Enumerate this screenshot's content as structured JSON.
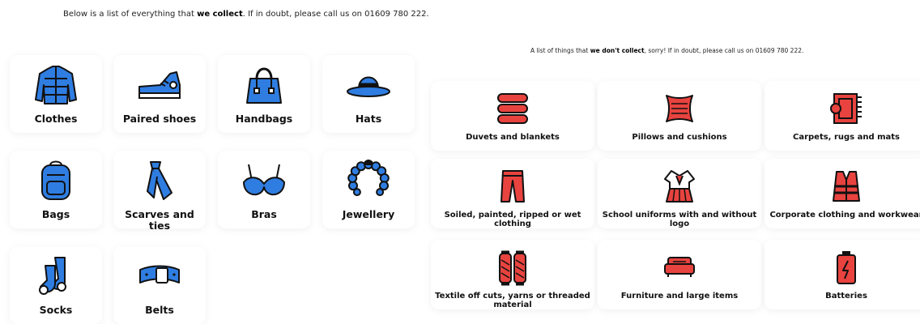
{
  "collect": {
    "intro": {
      "before": "Below is a list of everything that ",
      "bold": "we collect",
      "after": ". If in doubt, please call us on 01609 780 222."
    },
    "items": [
      {
        "label": "Clothes",
        "icon": "jacket-icon"
      },
      {
        "label": "Paired shoes",
        "icon": "sneaker-icon"
      },
      {
        "label": "Handbags",
        "icon": "handbag-icon"
      },
      {
        "label": "Hats",
        "icon": "hat-icon"
      },
      {
        "label": "Bags",
        "icon": "backpack-icon"
      },
      {
        "label": "Scarves and ties",
        "icon": "tie-icon"
      },
      {
        "label": "Bras",
        "icon": "bra-icon"
      },
      {
        "label": "Jewellery",
        "icon": "necklace-icon"
      },
      {
        "label": "Socks",
        "icon": "socks-icon"
      },
      {
        "label": "Belts",
        "icon": "belt-icon"
      }
    ]
  },
  "dont_collect": {
    "intro": {
      "before": "A list of things that ",
      "bold": "we don't collect",
      "after": ", sorry! If in doubt, please call us on 01609 780 222."
    },
    "items": [
      {
        "label": "Duvets and blankets",
        "icon": "blankets-icon"
      },
      {
        "label": "Pillows and cushions",
        "icon": "pillow-icon"
      },
      {
        "label": "Carpets, rugs and mats",
        "icon": "rug-icon"
      },
      {
        "label": "Soiled, painted, ripped or wet clothing",
        "icon": "trousers-icon"
      },
      {
        "label": "School uniforms with and without logo",
        "icon": "uniform-icon"
      },
      {
        "label": "Corporate clothing and workwear",
        "icon": "hi-vis-vest-icon"
      },
      {
        "label": "Textile off cuts, yarns or threaded material",
        "icon": "thread-spools-icon"
      },
      {
        "label": "Furniture and large items",
        "icon": "sofa-icon"
      },
      {
        "label": "Batteries",
        "icon": "battery-icon"
      }
    ]
  },
  "colors": {
    "collect_icon": "#2f7de1",
    "dont_collect_icon": "#e8433f",
    "outline": "#111111"
  }
}
